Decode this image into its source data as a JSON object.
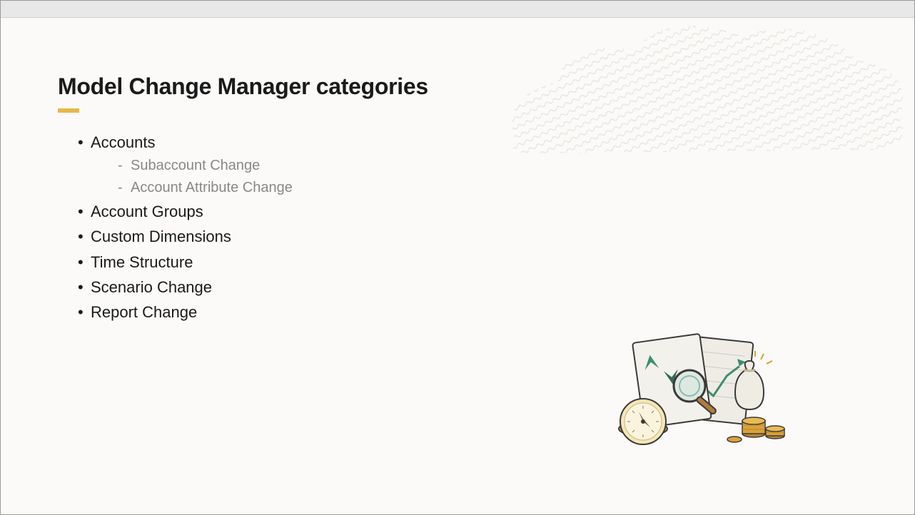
{
  "title": "Model Change Manager categories",
  "categories": [
    {
      "label": "Accounts",
      "sub": [
        "Subaccount Change",
        "Account Attribute Change"
      ]
    },
    {
      "label": "Account Groups"
    },
    {
      "label": "Custom Dimensions"
    },
    {
      "label": "Time Structure"
    },
    {
      "label": "Scenario Change"
    },
    {
      "label": "Report Change"
    }
  ]
}
